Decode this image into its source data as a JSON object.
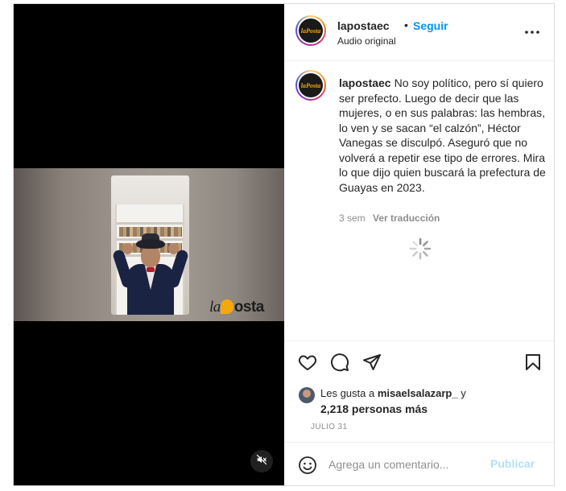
{
  "post": {
    "username": "lapostaec",
    "separator": "•",
    "follow_label": "Seguir",
    "audio_label": "Audio original",
    "avatar_text": "laPosta",
    "caption_user": "lapostaec",
    "caption_text": "No soy político, pero sí quiero ser prefecto. Luego de decir que las mujeres, o en sus palabras: las hembras, lo ven y se sacan “el calzón”, Héctor Vanegas se disculpó. Aseguró que no volverá a repetir ese tipo de errores. Mira lo que dijo quien buscará la prefectura de Guayas en 2023.",
    "time_ago": "3 sem",
    "translate_label": "Ver traducción"
  },
  "media": {
    "watermark_prefix": "la",
    "watermark_suffix": "osta",
    "mute_icon": "muted-speaker-icon"
  },
  "likes": {
    "prefix": "Les gusta a",
    "user": "misaelsalazarp_",
    "conjunction": "y",
    "others": "2,218 personas más"
  },
  "date": "JULIO 31",
  "comment": {
    "placeholder": "Agrega un comentario...",
    "publish_label": "Publicar"
  },
  "colors": {
    "link_blue": "#0095f6",
    "publish_disabled": "#b2dffc",
    "brand_orange": "#f5a80c"
  }
}
